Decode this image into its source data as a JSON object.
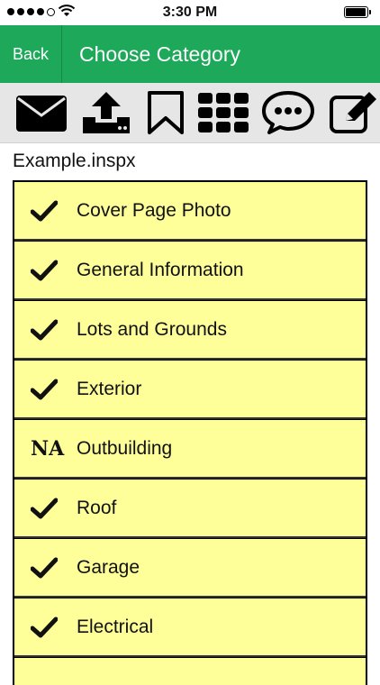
{
  "status_bar": {
    "time": "3:30 PM"
  },
  "nav": {
    "back_label": "Back",
    "title": "Choose Category"
  },
  "toolbar": {
    "icons": [
      "mail-icon",
      "upload-icon",
      "bookmark-icon",
      "grid-icon",
      "chat-icon",
      "edit-icon"
    ]
  },
  "file_name": "Example.inspx",
  "categories": [
    {
      "label": "Cover Page Photo",
      "status": "check"
    },
    {
      "label": "General Information",
      "status": "check"
    },
    {
      "label": "Lots and Grounds",
      "status": "check"
    },
    {
      "label": "Exterior",
      "status": "check"
    },
    {
      "label": "Outbuilding",
      "status": "NA"
    },
    {
      "label": "Roof",
      "status": "check"
    },
    {
      "label": "Garage",
      "status": "check"
    },
    {
      "label": "Electrical",
      "status": "check"
    }
  ],
  "colors": {
    "nav_bg": "#1da85a",
    "row_bg": "#ffff99",
    "toolbar_bg": "#e6e6e6"
  }
}
